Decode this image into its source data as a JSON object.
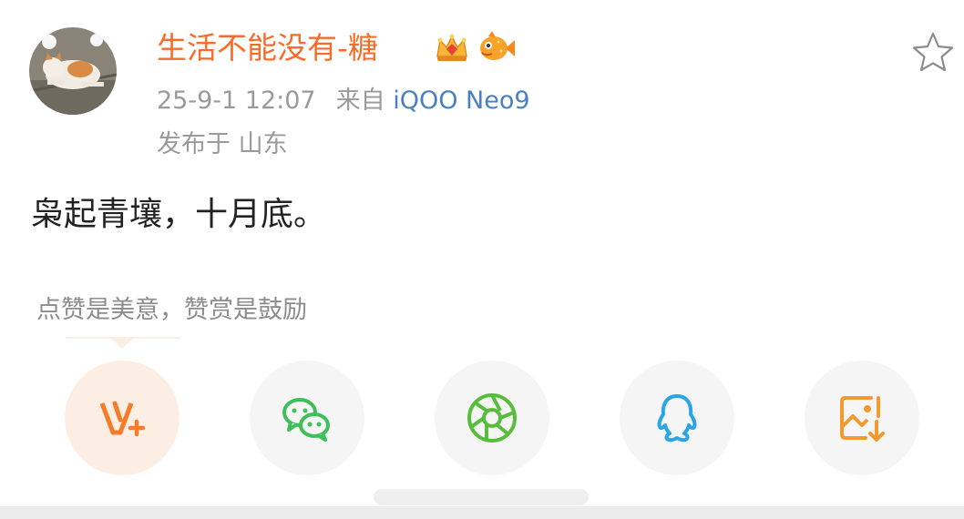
{
  "post": {
    "username": "生活不能没有-糖",
    "timestamp": "25-9-1 12:07",
    "source_prefix": "来自",
    "device": "iQOO Neo9",
    "location": "发布于 山东",
    "content": "枭起青壤，十月底。"
  },
  "reward_tip": "点赞是美意，赞赏是鼓励",
  "share_options": [
    {
      "name": "reward",
      "icon": "v-plus-icon"
    },
    {
      "name": "wechat",
      "icon": "wechat-icon"
    },
    {
      "name": "moments",
      "icon": "moments-icon"
    },
    {
      "name": "qq",
      "icon": "qq-icon"
    },
    {
      "name": "save-image",
      "icon": "save-image-icon"
    }
  ],
  "colors": {
    "username": "#f86c2b",
    "device_link": "#4a7fc1",
    "reward_accent": "#f57c2b",
    "wechat": "#3fbf5a",
    "moments": "#58bc3c",
    "qq": "#2aa6e6",
    "save": "#f39a2e"
  }
}
